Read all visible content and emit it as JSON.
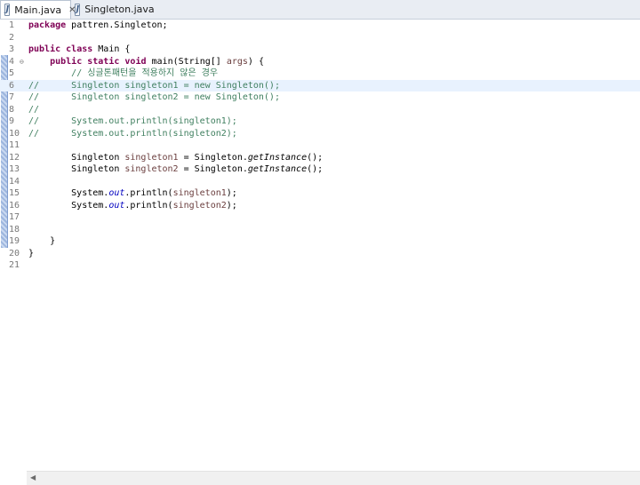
{
  "tabs": [
    {
      "label": "Main.java",
      "active": true,
      "icon": "java-file-icon",
      "closable": true
    },
    {
      "label": "Singleton.java",
      "active": false,
      "icon": "java-file-icon",
      "closable": false
    }
  ],
  "close_glyph": "✕",
  "fold_glyph": "⊖",
  "scroll_left_glyph": "◀",
  "editor": {
    "current_line": 6,
    "changed_lines": [
      4,
      19
    ],
    "lines": [
      {
        "n": "1",
        "tokens": [
          {
            "t": "kw",
            "v": "package"
          },
          {
            "t": "p",
            "v": " pattren.Singleton;"
          }
        ]
      },
      {
        "n": "2",
        "tokens": []
      },
      {
        "n": "3",
        "tokens": [
          {
            "t": "kw",
            "v": "public"
          },
          {
            "t": "p",
            "v": " "
          },
          {
            "t": "kw",
            "v": "class"
          },
          {
            "t": "p",
            "v": " Main {"
          }
        ]
      },
      {
        "n": "4",
        "fold": true,
        "tokens": [
          {
            "t": "p",
            "v": "    "
          },
          {
            "t": "kw",
            "v": "public"
          },
          {
            "t": "p",
            "v": " "
          },
          {
            "t": "kw",
            "v": "static"
          },
          {
            "t": "p",
            "v": " "
          },
          {
            "t": "kw",
            "v": "void"
          },
          {
            "t": "p",
            "v": " main(String[] "
          },
          {
            "t": "lv",
            "v": "args"
          },
          {
            "t": "p",
            "v": ") {"
          }
        ]
      },
      {
        "n": "5",
        "tokens": [
          {
            "t": "p",
            "v": "        "
          },
          {
            "t": "cm",
            "v": "// 싱글톤패턴을 적용하지 않은 경우"
          }
        ]
      },
      {
        "n": "6",
        "tokens": [
          {
            "t": "cm",
            "v": "//      Singleton singleton1 = new Singleton();"
          }
        ]
      },
      {
        "n": "7",
        "tokens": [
          {
            "t": "cm",
            "v": "//      Singleton singleton2 = new Singleton();"
          }
        ]
      },
      {
        "n": "8",
        "tokens": [
          {
            "t": "cm",
            "v": "//"
          }
        ]
      },
      {
        "n": "9",
        "tokens": [
          {
            "t": "cm",
            "v": "//      System.out.println(singleton1);"
          }
        ]
      },
      {
        "n": "10",
        "tokens": [
          {
            "t": "cm",
            "v": "//      System.out.println(singleton2);"
          }
        ]
      },
      {
        "n": "11",
        "tokens": []
      },
      {
        "n": "12",
        "tokens": [
          {
            "t": "p",
            "v": "        Singleton "
          },
          {
            "t": "lv",
            "v": "singleton1"
          },
          {
            "t": "p",
            "v": " = Singleton."
          },
          {
            "t": "sm",
            "v": "getInstance"
          },
          {
            "t": "p",
            "v": "();"
          }
        ]
      },
      {
        "n": "13",
        "tokens": [
          {
            "t": "p",
            "v": "        Singleton "
          },
          {
            "t": "lv",
            "v": "singleton2"
          },
          {
            "t": "p",
            "v": " = Singleton."
          },
          {
            "t": "sm",
            "v": "getInstance"
          },
          {
            "t": "p",
            "v": "();"
          }
        ]
      },
      {
        "n": "14",
        "tokens": []
      },
      {
        "n": "15",
        "tokens": [
          {
            "t": "p",
            "v": "        System."
          },
          {
            "t": "fld",
            "v": "out"
          },
          {
            "t": "p",
            "v": ".println("
          },
          {
            "t": "lv",
            "v": "singleton1"
          },
          {
            "t": "p",
            "v": ");"
          }
        ]
      },
      {
        "n": "16",
        "tokens": [
          {
            "t": "p",
            "v": "        System."
          },
          {
            "t": "fld",
            "v": "out"
          },
          {
            "t": "p",
            "v": ".println("
          },
          {
            "t": "lv",
            "v": "singleton2"
          },
          {
            "t": "p",
            "v": ");"
          }
        ]
      },
      {
        "n": "17",
        "tokens": []
      },
      {
        "n": "18",
        "tokens": []
      },
      {
        "n": "19",
        "tokens": [
          {
            "t": "p",
            "v": "    }"
          }
        ]
      },
      {
        "n": "20",
        "tokens": [
          {
            "t": "p",
            "v": "}"
          }
        ]
      },
      {
        "n": "21",
        "tokens": []
      }
    ]
  },
  "colors": {
    "keyword": "#7f0055",
    "comment": "#3f7f5f",
    "local_variable": "#6a3e3e",
    "static_field": "#0000c0",
    "current_line_bg": "#e8f2fe"
  }
}
